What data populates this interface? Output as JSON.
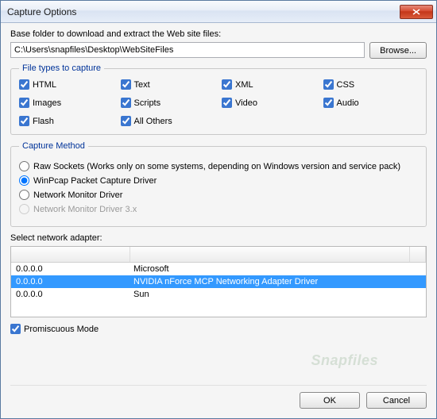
{
  "window": {
    "title": "Capture Options"
  },
  "baseFolder": {
    "label": "Base folder to download and extract the Web site files:",
    "value": "C:\\Users\\snapfiles\\Desktop\\WebSiteFiles",
    "browse": "Browse..."
  },
  "fileTypes": {
    "legend": "File types to capture",
    "items": [
      {
        "label": "HTML",
        "checked": true
      },
      {
        "label": "Text",
        "checked": true
      },
      {
        "label": "XML",
        "checked": true
      },
      {
        "label": "CSS",
        "checked": true
      },
      {
        "label": "Images",
        "checked": true
      },
      {
        "label": "Scripts",
        "checked": true
      },
      {
        "label": "Video",
        "checked": true
      },
      {
        "label": "Audio",
        "checked": true
      },
      {
        "label": "Flash",
        "checked": true
      },
      {
        "label": "All Others",
        "checked": true
      }
    ]
  },
  "captureMethod": {
    "legend": "Capture Method",
    "options": [
      {
        "label": "Raw Sockets  (Works only on some systems, depending on Windows version and service pack)",
        "selected": false,
        "disabled": false
      },
      {
        "label": "WinPcap Packet Capture Driver",
        "selected": true,
        "disabled": false
      },
      {
        "label": "Network Monitor Driver",
        "selected": false,
        "disabled": false
      },
      {
        "label": "Network Monitor Driver 3.x",
        "selected": false,
        "disabled": true
      }
    ]
  },
  "adapters": {
    "label": "Select network adapter:",
    "rows": [
      {
        "ip": "0.0.0.0",
        "name": "Microsoft",
        "selected": false
      },
      {
        "ip": "0.0.0.0",
        "name": "NVIDIA nForce MCP Networking Adapter Driver",
        "selected": true
      },
      {
        "ip": "0.0.0.0",
        "name": "Sun",
        "selected": false
      }
    ]
  },
  "promiscuous": {
    "label": "Promiscuous Mode",
    "checked": true
  },
  "buttons": {
    "ok": "OK",
    "cancel": "Cancel"
  },
  "watermark": "Snapfiles"
}
